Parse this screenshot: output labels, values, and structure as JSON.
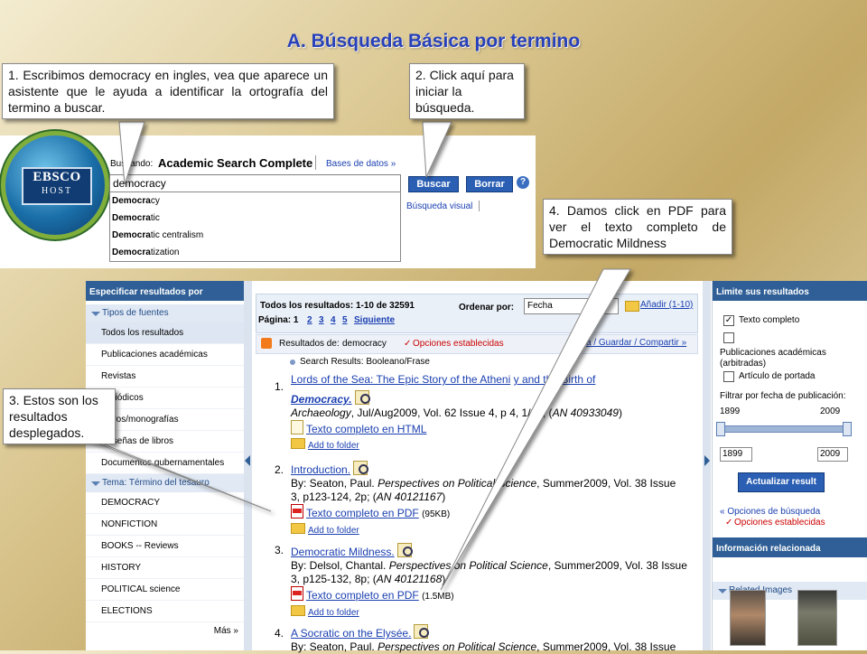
{
  "slide": {
    "title": "A. Búsqueda Básica por termino",
    "callout1": "1. Escribimos democracy en ingles, vea que aparece un asistente que le ayuda a identificar la ortografía del termino a buscar.",
    "callout2": "2. Click aquí para iniciar la búsqueda.",
    "callout3": "3. Estos son los resultados desplegados.",
    "callout4": "4. Damos click en PDF para ver el texto completo de Democratic Mildness"
  },
  "logo": {
    "line1": "EBSCO",
    "line2": "HOST"
  },
  "search": {
    "searching_label": "Buscando:",
    "database": "Academic Search Complete",
    "databases_link": "Bases de datos »",
    "query": "democracy",
    "search_button": "Buscar",
    "clear_button": "Borrar",
    "help_icon": "?",
    "visual_search": "Búsqueda visual",
    "suggestions": [
      {
        "match": "Democra",
        "rest": "cy"
      },
      {
        "match": "Democra",
        "rest": "tic"
      },
      {
        "match": "Democra",
        "rest": "tic centralism"
      },
      {
        "match": "Democra",
        "rest": "tization"
      }
    ]
  },
  "left": {
    "header": "Especificar resultados por",
    "source_types_header": "Tipos de fuentes",
    "source_types": [
      "Todos los resultados",
      "Publicaciones académicas",
      "Revistas",
      "Periódicos",
      "Libros/monografías",
      "Reseñas de libros",
      "Documentos gubernamentales"
    ],
    "subject_header": "Tema: Término del tesauro",
    "subjects": [
      "DEMOCRACY",
      "NONFICTION",
      "BOOKS -- Reviews",
      "HISTORY",
      "POLITICAL science",
      "ELECTIONS"
    ],
    "more": "Más »"
  },
  "results": {
    "summary": "Todos los resultados: 1-10 de 32591",
    "sort_label": "Ordenar por:",
    "sort_value": "Fecha",
    "add_link": "Añadir (1-10)",
    "page_label": "Página: 1",
    "pages": [
      "2",
      "3",
      "4",
      "5"
    ],
    "next": "Siguiente",
    "results_for_label": "Resultados de:",
    "results_for_term": "democracy",
    "options_set": "Opciones establecidas",
    "print_share": "a / Guardar / Compartir »",
    "search_mode": "Search Results: Booleano/Frase",
    "items": [
      {
        "num": "1.",
        "title1": "Lords of the Sea: The Epic Story of the Atheni",
        "title1b": "y and the Birth of",
        "title2": "Democracy.",
        "meta1_italic": "Archaeology",
        "meta1": ", Jul/Aug2009, Vol. 62 Issue 4, p",
        "meta1b": "4, 1/9p; (",
        "meta1_an": "AN 40933049",
        "meta1_end": ")",
        "full_text": "Texto completo en HTML",
        "add": "Add to folder"
      },
      {
        "num": "2.",
        "title": "Introduction.",
        "byline": "By: Seaton, Paul. ",
        "journal": "Perspectives on Political Science",
        "meta": ", Summer2009, Vol. 38 Issue",
        "meta2": "3, p123-124, 2p; (",
        "an": "AN 40121167",
        "pdf": "Texto completo en PDF",
        "size": "(95KB)",
        "add": "Add to folder"
      },
      {
        "num": "3.",
        "title": "Democratic Mildness.",
        "byline": "By: Delsol, Chantal. ",
        "journal": "Perspectives on Political Science",
        "meta": ", Summer2009, Vol. 38 Issue",
        "meta2": "3, p125-132, 8p; (",
        "an": "AN 40121168",
        "pdf": "Texto completo en PDF",
        "size": "(1.5MB)",
        "add": "Add to folder"
      },
      {
        "num": "4.",
        "title": "A Socratic on the Elysée.",
        "byline": "By: Seaton, Paul. ",
        "journal": "Perspectives on Political Science",
        "meta": ", Summer2009, Vol. 38 Issue"
      }
    ]
  },
  "right": {
    "header": "Limite sus resultados",
    "full_text": "Texto completo",
    "academic": "Publicaciones académicas (arbitradas)",
    "cover": "Artículo de portada",
    "date_filter": "Filtrar por fecha de publicación:",
    "from": "1899",
    "to": "2009",
    "update": "Actualizar result",
    "search_options": "« Opciones de búsqueda",
    "options_set": "Opciones establecidas",
    "related_header": "Información relacionada",
    "related_images": "Related Images"
  }
}
